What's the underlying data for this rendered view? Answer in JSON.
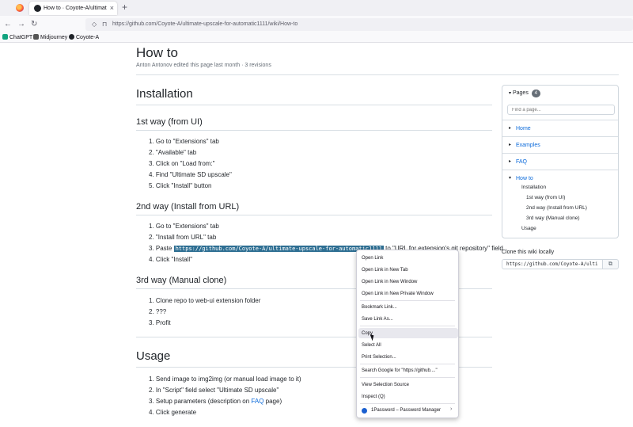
{
  "browser": {
    "tab_title": "How to · Coyote-A/ultimate-up",
    "tab_close": "×",
    "new_tab": "+",
    "url": "https://github.com/Coyote-A/ultimate-upscale-for-automatic1111/wiki/How-to",
    "bookmarks": [
      "ChatGPT",
      "Midjourney",
      "Coyote-A"
    ]
  },
  "page": {
    "title": "How to",
    "meta": "Anton Antonov edited this page last month · 3 revisions"
  },
  "installation": {
    "heading": "Installation",
    "way1": {
      "heading": "1st way (from UI)",
      "steps": [
        "1. Go to \"Extensions\" tab",
        "2. \"Available\" tab",
        "3. Click on \"Load from:\"",
        "4. Find \"Ultimate SD upscale\"",
        "5. Click \"Install\" button"
      ]
    },
    "way2": {
      "heading": "2nd way (Install from URL)",
      "steps": [
        "1. Go to \"Extensions\" tab",
        "2. \"Install from URL\" tab"
      ],
      "step3_prefix": "3. Paste",
      "step3_code": "https://github.com/Coyote-A/ultimate-upscale-for-automatic1111",
      "step3_suffix": "to \"URL for extension's git repository\" field",
      "step4": "4. Click \"Install\""
    },
    "way3": {
      "heading": "3rd way (Manual clone)",
      "steps": [
        "1. Clone repo to web-ui extension folder",
        "2. ???",
        "3. Profit"
      ]
    }
  },
  "usage": {
    "heading": "Usage",
    "step1": "1. Send image to img2img (or manual load image to it)",
    "step2": "2. In \"Script\" field select \"Ultimate SD upscale\"",
    "step3_prefix": "3. Setup parameters (description on ",
    "step3_link": "FAQ",
    "step3_suffix": " page)",
    "step4": "4. Click generate"
  },
  "sidebar": {
    "pages_label": "Pages",
    "pages_count": "4",
    "find_placeholder": "Find a page...",
    "items": [
      "Home",
      "Examples",
      "FAQ",
      "How to"
    ],
    "subitems": [
      "Installation",
      "1st way (from UI)",
      "2nd way (Install from URL)",
      "3rd way (Manual clone)",
      "Usage"
    ],
    "clone_label": "Clone this wiki locally",
    "clone_url": "https://github.com/Coyote-A/ulti"
  },
  "context_menu": {
    "items": [
      "Open Link",
      "Open Link in New Tab",
      "Open Link in New Window",
      "Open Link in New Private Window",
      "Bookmark Link...",
      "Save Link As...",
      "Copy",
      "Select All",
      "Print Selection...",
      "Search Google for \"https://github....\"",
      "View Selection Source",
      "Inspect (Q)",
      "1Password – Password Manager"
    ]
  }
}
